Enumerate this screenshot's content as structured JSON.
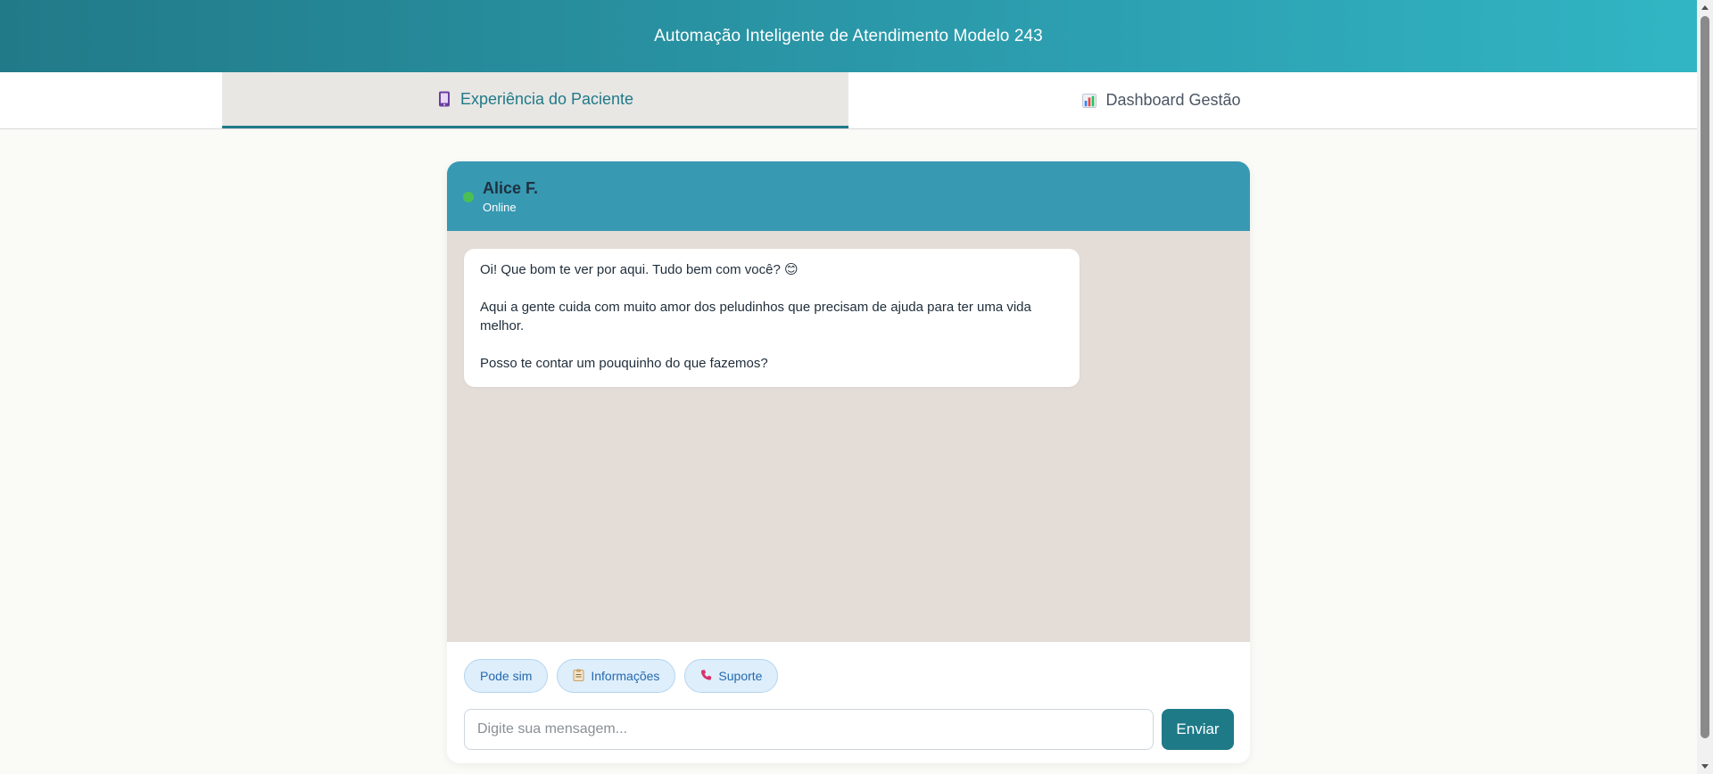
{
  "app": {
    "title": "Automação Inteligente de Atendimento Modelo 243"
  },
  "tabs": [
    {
      "label": "Experiência do Paciente",
      "icon": "mobile-phone-icon",
      "active": true
    },
    {
      "label": "Dashboard Gestão",
      "icon": "bar-chart-icon",
      "active": false
    }
  ],
  "chat": {
    "contact_name": "Alice F.",
    "status": "Online",
    "status_color": "#4cbf54",
    "messages": [
      {
        "sender": "bot",
        "paragraphs": [
          "Oi! Que bom te ver por aqui. Tudo bem com você? 😊",
          "Aqui a gente cuida com muito amor dos peludinhos que precisam de ajuda para ter uma vida melhor.",
          "Posso te contar um pouquinho do que fazemos?"
        ]
      }
    ],
    "quick_replies": [
      {
        "label": "Pode sim",
        "icon": ""
      },
      {
        "label": "Informações",
        "icon": "clipboard-icon"
      },
      {
        "label": "Suporte",
        "icon": "phone-icon"
      }
    ],
    "input_placeholder": "Digite sua mensagem...",
    "input_value": "",
    "send_label": "Enviar"
  },
  "colors": {
    "primary": "#1f7a88",
    "chat_header": "#3899b2",
    "chat_background": "#e3dcd7"
  }
}
